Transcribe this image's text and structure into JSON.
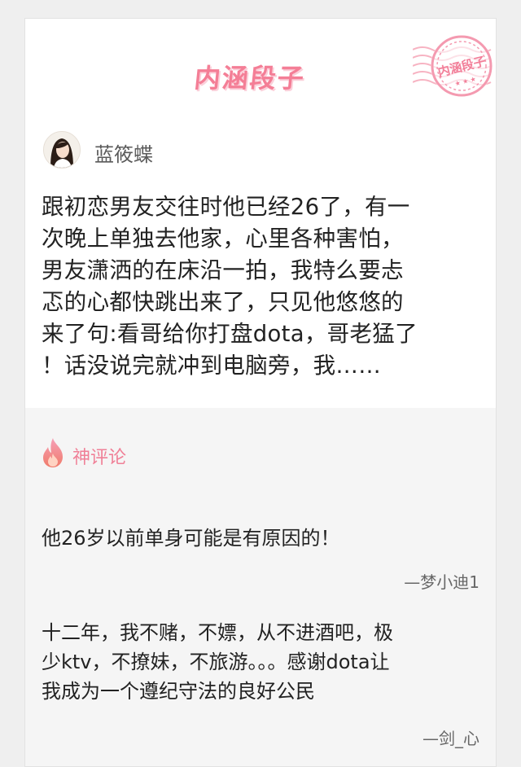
{
  "header": {
    "brand_title": "内涵段子",
    "stamp_text": "内涵段子"
  },
  "post": {
    "author_name": "蓝筱蝶",
    "content_lines": [
      "跟初恋男友交往时他已经26了，有一",
      "次晚上单独去他家，心里各种害怕，",
      "男友潇洒的在床沿一拍，我特么要忐",
      "忑的心都快跳出来了，只见他悠悠的",
      "来了句:看哥给你打盘dota，哥老猛了",
      "！话没说完就冲到电脑旁，我……"
    ]
  },
  "comments_section": {
    "label": "神评论",
    "comments": [
      {
        "lines": [
          "他26岁以前单身可能是有原因的！"
        ],
        "author": "—梦小迪1"
      },
      {
        "lines": [
          "十二年，我不赌，不嫖，从不进酒吧，极",
          "少ktv，不撩妹，不旅游。。。感谢dota让",
          "我成为一个遵纪守法的良好公民"
        ],
        "author": "—剑_心"
      }
    ]
  },
  "colors": {
    "brand_pink": "#f47e96",
    "comment_bg": "#f5f5f5",
    "card_bg": "#ffffff"
  },
  "icons": {
    "stamp": "postmark-stamp-icon",
    "flame": "flame-icon",
    "avatar": "user-avatar"
  }
}
